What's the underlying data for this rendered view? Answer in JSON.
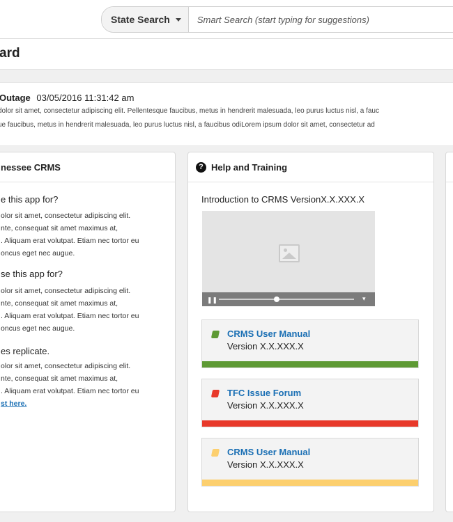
{
  "search": {
    "scope_label": "State Search",
    "placeholder": "Smart Search (start typing for suggestions)"
  },
  "page": {
    "title": "ard"
  },
  "outage": {
    "title": "Outage",
    "datetime": "03/05/2016 11:31:42 am",
    "line1": "dolor sit amet, consectetur adipiscing elit. Pellentesque faucibus, metus in hendrerit malesuada, leo purus luctus nisl, a fauc",
    "line2": "ue faucibus, metus in hendrerit malesuada, leo purus luctus nisl, a faucibus odiLorem ipsum dolor sit amet, consectetur ad"
  },
  "about_card": {
    "title": "nessee CRMS",
    "sections": [
      {
        "question": "e this app for?",
        "lines": [
          "olor sit amet, consectetur adipiscing elit.",
          "nte, consequat sit amet maximus at,",
          ". Aliquam erat volutpat. Etiam nec tortor eu",
          "oncus eget nec augue."
        ]
      },
      {
        "question": "se this app for?",
        "lines": [
          "olor sit amet, consectetur adipiscing elit.",
          "nte, consequat sit amet maximus at,",
          ". Aliquam erat volutpat. Etiam nec tortor eu",
          "oncus eget nec augue."
        ]
      },
      {
        "question": "es replicate.",
        "lines": [
          "olor sit amet, consectetur adipiscing elit.",
          "nte, consequat sit amet maximus at,",
          ". Aliquam erat volutpat. Etiam nec tortor eu"
        ],
        "link": "st here."
      }
    ]
  },
  "help_card": {
    "title": "Help and Training",
    "video_title": "Introduction to CRMS VersionX.X.XXX.X",
    "video_progress": 0.43,
    "links": [
      {
        "title": "CRMS User Manual",
        "version": "Version X.X.XXX.X",
        "color": "#5e9a34",
        "icon": "book-icon"
      },
      {
        "title": "TFC Issue Forum",
        "version": "Version X.X.XXX.X",
        "color": "#e8392a",
        "icon": "book-icon"
      },
      {
        "title": "CRMS User Manual",
        "version": "Version X.X.XXX.X",
        "color": "#fccf6e",
        "icon": "book-icon"
      }
    ]
  }
}
